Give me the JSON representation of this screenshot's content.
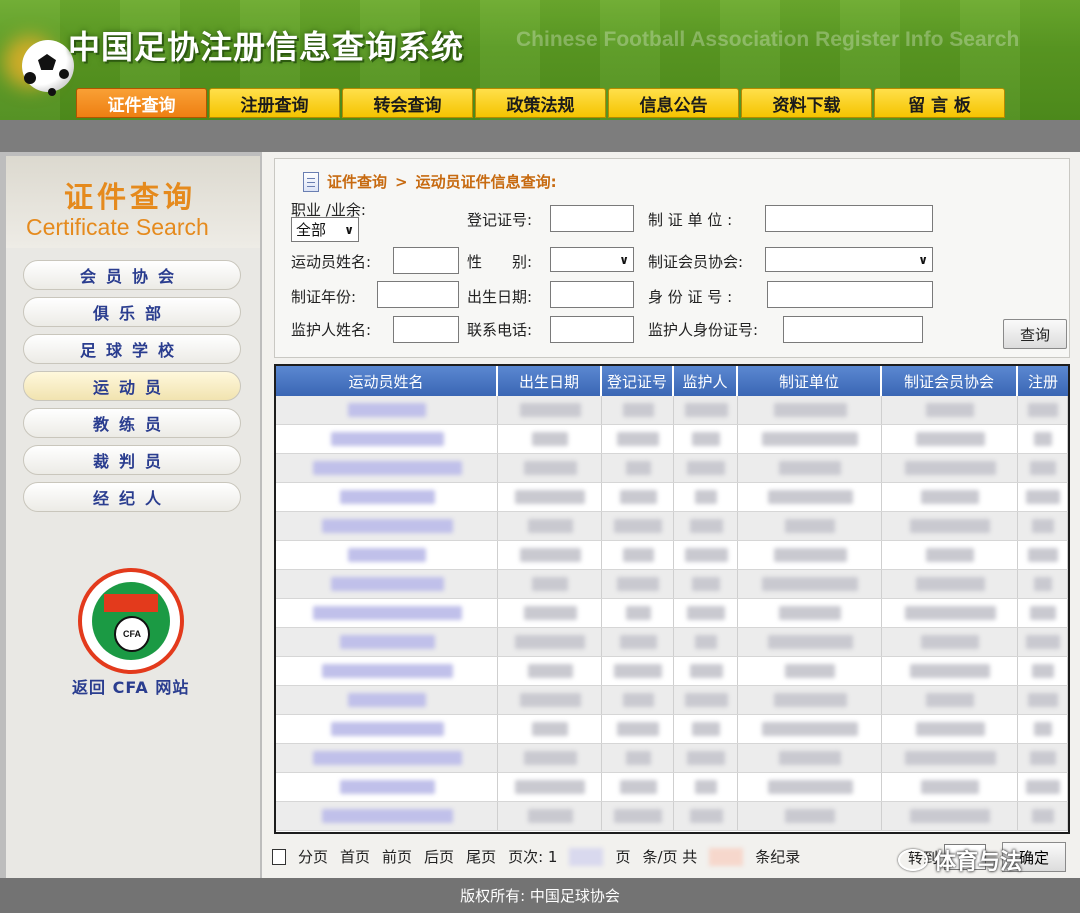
{
  "header": {
    "title_cn": "中国足协注册信息查询系统",
    "title_en": "Chinese Football Association Register Info Search"
  },
  "nav": {
    "items": [
      {
        "label": "证件查询",
        "active": true
      },
      {
        "label": "注册查询",
        "active": false
      },
      {
        "label": "转会查询",
        "active": false
      },
      {
        "label": "政策法规",
        "active": false
      },
      {
        "label": "信息公告",
        "active": false
      },
      {
        "label": "资料下载",
        "active": false
      },
      {
        "label": "留 言 板",
        "active": false
      }
    ]
  },
  "sidebar": {
    "title_cn": "证件查询",
    "title_en": "Certificate Search",
    "items": [
      {
        "label": "会员协会",
        "active": false
      },
      {
        "label": "俱乐部",
        "active": false
      },
      {
        "label": "足球学校",
        "active": false
      },
      {
        "label": "运动员",
        "active": true
      },
      {
        "label": "教练员",
        "active": false
      },
      {
        "label": "裁判员",
        "active": false
      },
      {
        "label": "经纪人",
        "active": false
      }
    ],
    "back_link": "返回 CFA 网站",
    "logo_text": "CFA"
  },
  "breadcrumb": {
    "part1": "证件查询",
    "sep": ">",
    "part2": "运动员证件信息查询:"
  },
  "form": {
    "profession_label": "职业 /业余:",
    "profession_value": "全部",
    "reg_no_label": "登记证号:",
    "issuer_label": "制 证 单 位 :",
    "name_label": "运动员姓名:",
    "gender_label": "性　　别:",
    "assoc_label": "制证会员协会:",
    "year_label": "制证年份:",
    "birth_label": "出生日期:",
    "id_label": "身 份 证 号 :",
    "guardian_label": "监护人姓名:",
    "phone_label": "联系电话:",
    "guardian_id_label": "监护人身份证号:",
    "query_button": "查询"
  },
  "table": {
    "columns": [
      "运动员姓名",
      "出生日期",
      "登记证号",
      "监护人",
      "制证单位",
      "制证会员协会",
      "注册"
    ],
    "row_count": 15
  },
  "pager": {
    "paging": "分页",
    "first": "首页",
    "prev": "前页",
    "next": "后页",
    "last": "尾页",
    "page_label": "页次: 1",
    "page_suffix": "页",
    "per_page": "条/页 共",
    "records": "条纪录",
    "goto": "转到",
    "ok_button": "确定",
    "watermark": "体育与法"
  },
  "footer": {
    "copyright": "版权所有: 中国足球协会"
  },
  "colors": {
    "header_green": "#5a9a22",
    "nav_yellow": "#f5c400",
    "nav_active_orange": "#ee7f12",
    "table_header_blue": "#3a66b4",
    "sidebar_title_orange": "#e58a1d"
  }
}
